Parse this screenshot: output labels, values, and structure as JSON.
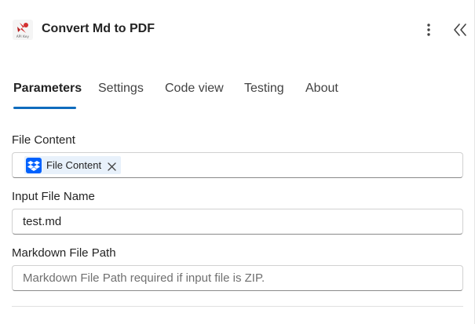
{
  "header": {
    "title": "Convert Md to PDF",
    "logo_caption": "API Key",
    "more_icon": "more-vertical-icon",
    "collapse_icon": "double-chevron-left-icon"
  },
  "tabs": [
    {
      "label": "Parameters",
      "active": true
    },
    {
      "label": "Settings",
      "active": false
    },
    {
      "label": "Code view",
      "active": false
    },
    {
      "label": "Testing",
      "active": false
    },
    {
      "label": "About",
      "active": false
    }
  ],
  "fields": {
    "file_content": {
      "label": "File Content",
      "token_label": "File Content",
      "token_icon": "dropbox-icon"
    },
    "input_file_name": {
      "label": "Input File Name",
      "value": "test.md"
    },
    "markdown_file_path": {
      "label": "Markdown File Path",
      "value": "",
      "placeholder": "Markdown File Path required if input file is ZIP."
    }
  },
  "colors": {
    "accent": "#0f6cbd",
    "token_bg": "#e8f1fb",
    "dropbox_blue": "#0061fe"
  }
}
